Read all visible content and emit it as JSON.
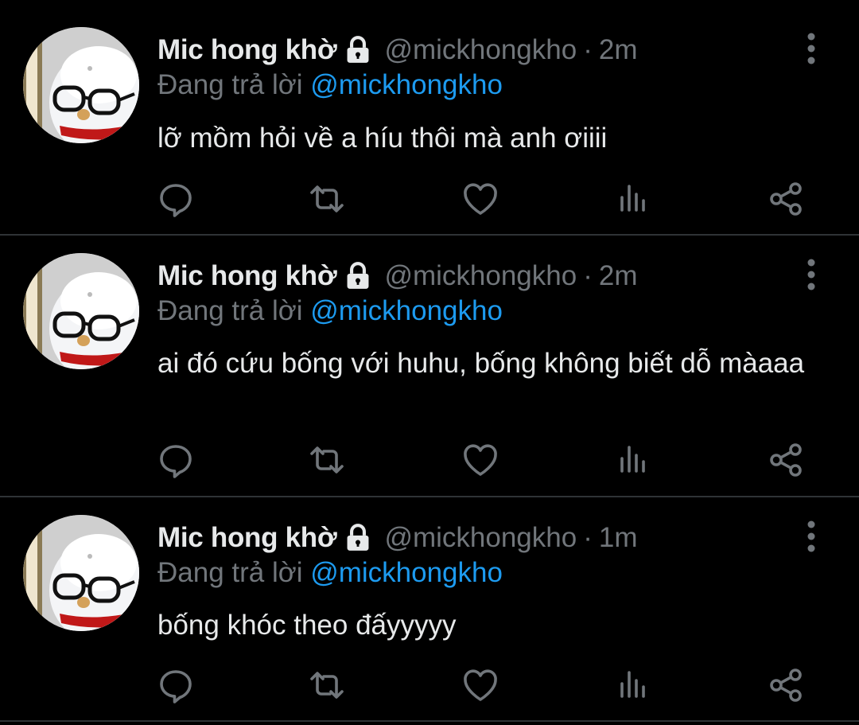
{
  "colors": {
    "background": "#000000",
    "primary_text": "#e7e9ea",
    "secondary_text": "#71767b",
    "mention": "#1d9bf0",
    "divider": "#2f3336"
  },
  "icons": {
    "lock": "lock-icon",
    "more": "more-vertical-icon",
    "reply": "reply-bubble-icon",
    "retweet": "retweet-icon",
    "like": "heart-icon",
    "views": "views-bar-chart-icon",
    "share": "share-icon"
  },
  "tweets": [
    {
      "name": "Mic hong khờ",
      "handle": "@mickhongkho",
      "separator": "·",
      "time": "2m",
      "reply_prefix": "Đang trả lời",
      "reply_to": "@mickhongkho",
      "text": "lỡ mồm hỏi về a híu thôi mà anh ơiiii"
    },
    {
      "name": "Mic hong khờ",
      "handle": "@mickhongkho",
      "separator": "·",
      "time": "2m",
      "reply_prefix": "Đang trả lời",
      "reply_to": "@mickhongkho",
      "text": "ai đó cứu bống với huhu, bống không biết dỗ màaaa"
    },
    {
      "name": "Mic hong khờ",
      "handle": "@mickhongkho",
      "separator": "·",
      "time": "1m",
      "reply_prefix": "Đang trả lời",
      "reply_to": "@mickhongkho",
      "text": "bống khóc theo đấyyyyy"
    }
  ]
}
